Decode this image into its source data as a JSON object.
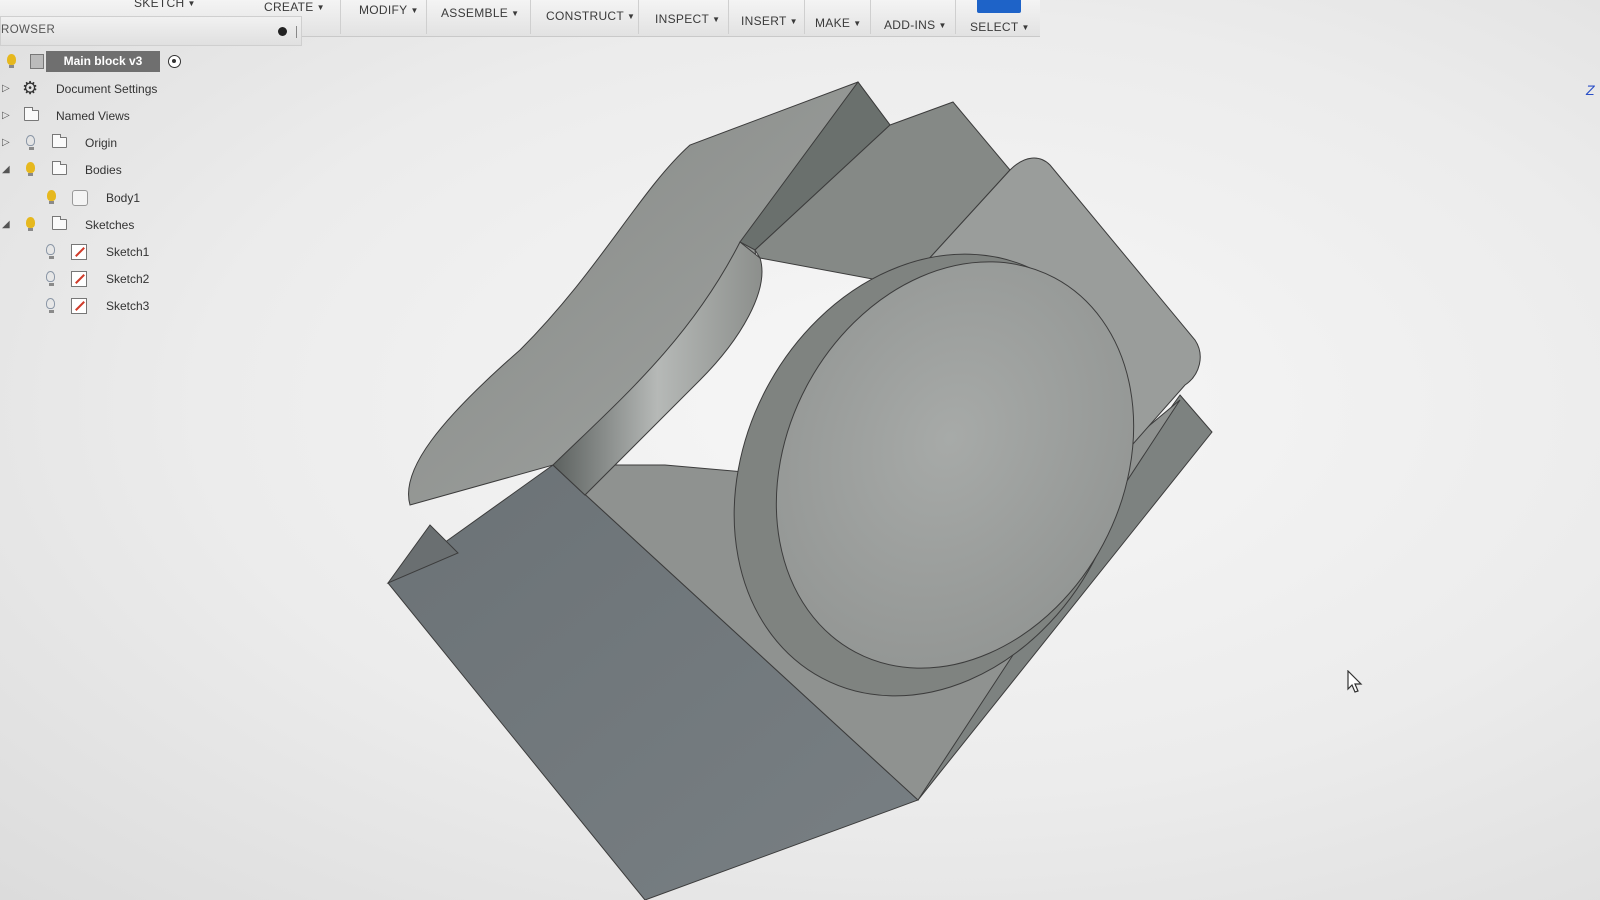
{
  "toolbar": {
    "items": [
      {
        "label": "SKETCH"
      },
      {
        "label": "CREATE"
      },
      {
        "label": "MODIFY"
      },
      {
        "label": "ASSEMBLE"
      },
      {
        "label": "CONSTRUCT"
      },
      {
        "label": "INSPECT"
      },
      {
        "label": "INSERT"
      },
      {
        "label": "MAKE"
      },
      {
        "label": "ADD-INS"
      },
      {
        "label": "SELECT"
      }
    ]
  },
  "browser": {
    "title": "ROWSER",
    "root": {
      "label": "Main block v3"
    },
    "items": [
      {
        "label": "Document Settings",
        "icon": "gear-icon"
      },
      {
        "label": "Named Views",
        "icon": "folder-icon"
      },
      {
        "label": "Origin",
        "icon": "folder-icon"
      },
      {
        "label": "Bodies",
        "icon": "folder-icon"
      },
      {
        "label": "Body1",
        "icon": "body-icon"
      },
      {
        "label": "Sketches",
        "icon": "folder-icon"
      },
      {
        "label": "Sketch1",
        "icon": "sketch-icon"
      },
      {
        "label": "Sketch2",
        "icon": "sketch-icon"
      },
      {
        "label": "Sketch3",
        "icon": "sketch-icon"
      }
    ]
  },
  "viewcube": {
    "axis_label": "Z"
  },
  "colors": {
    "accent": "#1e63c8",
    "bulb_on": "#e6b81e",
    "model_light": "#8c8f8c",
    "model_dark": "#6d7377",
    "root_bg": "#6f6f6f"
  }
}
